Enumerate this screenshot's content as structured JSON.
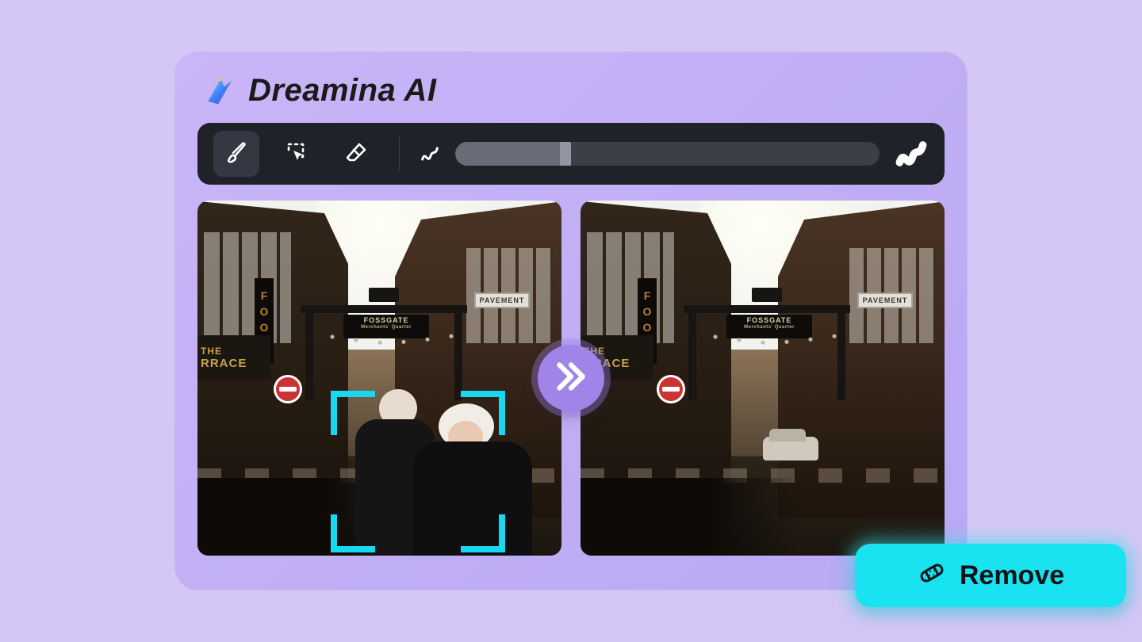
{
  "brand": {
    "name": "Dreamina AI"
  },
  "toolbar": {
    "tools": [
      {
        "name": "brush",
        "active": true
      },
      {
        "name": "lasso-select",
        "active": false
      },
      {
        "name": "eraser",
        "active": false
      }
    ],
    "brush_size": {
      "percent": 26
    }
  },
  "scene": {
    "arch_sign_top": "FOSSGATE",
    "arch_sign_sub": "Merchants' Quarter",
    "street_sign": "PAVEMENT",
    "shop_sign_line1": "THE",
    "shop_sign_line2": "RRACE",
    "vertical_banner": "FOOD"
  },
  "action": {
    "remove_label": "Remove"
  },
  "colors": {
    "accent_cyan": "#19e3f0",
    "selection_cyan": "#19d7ee",
    "badge_purple": "#a184e8",
    "toolbar_bg": "#1f2329",
    "card_grad_a": "#c9b5f7",
    "card_grad_b": "#b9a8f3",
    "page_bg": "#d4c7f5"
  }
}
